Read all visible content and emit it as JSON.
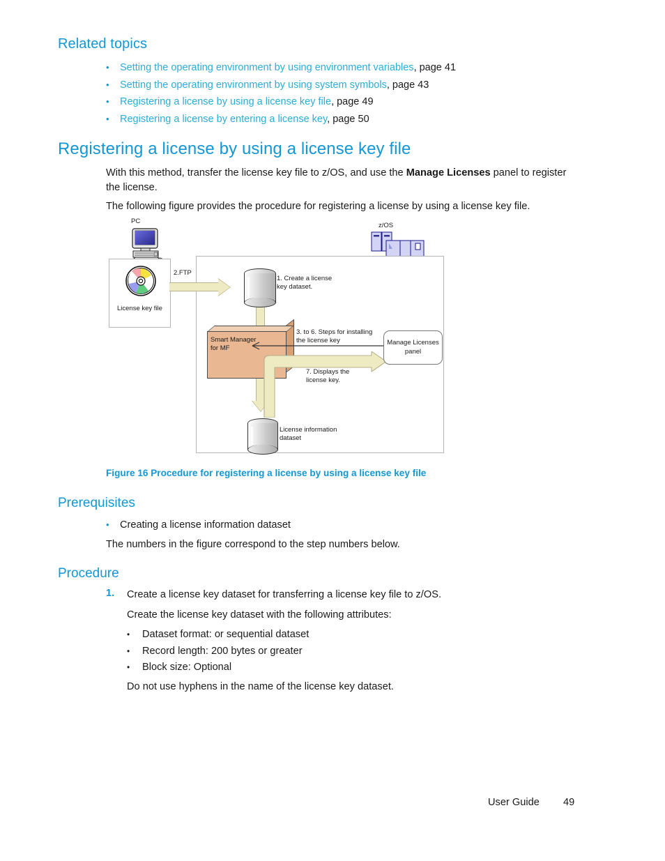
{
  "related_topics": {
    "heading": "Related topics",
    "items": [
      {
        "link": "Setting the operating environment by using environment variables",
        "page": ", page 41"
      },
      {
        "link": "Setting the operating environment by using system symbols",
        "page": ", page 43"
      },
      {
        "link": "Registering a license by using a license key file",
        "page": ", page 49"
      },
      {
        "link": "Registering a license by entering a license key",
        "page": ", page 50"
      }
    ]
  },
  "section": {
    "heading": "Registering a license by using a license key file",
    "para1_a": "With this method, transfer the license key file to z/OS, and use the ",
    "para1_bold": "Manage Licenses",
    "para1_b": " panel to register the license.",
    "para2": "The following figure provides the procedure for registering a license by using a license key file."
  },
  "figure": {
    "caption": "Figure 16 Procedure for registering a license by using a license key file",
    "labels": {
      "pc": "PC",
      "zos": "z/OS",
      "license_key_file": "License key file",
      "ftp": "2.FTP",
      "step1": "1. Create a license\nkey dataset.",
      "step36": "3. to 6. Steps for installing\nthe license key",
      "step7": "7. Displays the\nlicense key.",
      "smart_manager": "Smart Manager\nfor MF",
      "manage_licenses_panel": "Manage Licenses\npanel",
      "license_information_dataset": "License information\ndataset"
    },
    "colors": {
      "arrow_fill": "#eeeac2",
      "arrow_stroke": "#b8b48e",
      "box_fill": "#e9b791",
      "server_fill": "#ccccf2",
      "frame_stroke": "#b5b5b5"
    }
  },
  "prerequisites": {
    "heading": "Prerequisites",
    "bullet": "Creating a license information dataset",
    "note": "The numbers in the figure correspond to the step numbers below."
  },
  "procedure": {
    "heading": "Procedure",
    "step_number": "1.",
    "step_text": "Create a license key dataset for transferring a license key file to z/OS.",
    "sub_para": "Create the license key dataset with the following attributes:",
    "attributes": [
      "Dataset format:      or      sequential dataset",
      "Record length: 200 bytes or greater",
      "Block size: Optional"
    ],
    "closing": "Do not use hyphens in the name of the license key dataset."
  },
  "footer": {
    "label": "User Guide",
    "page": "49"
  },
  "theme": {
    "accent": "#1397d5",
    "link": "#2badd8",
    "text": "#1a1a1a"
  }
}
